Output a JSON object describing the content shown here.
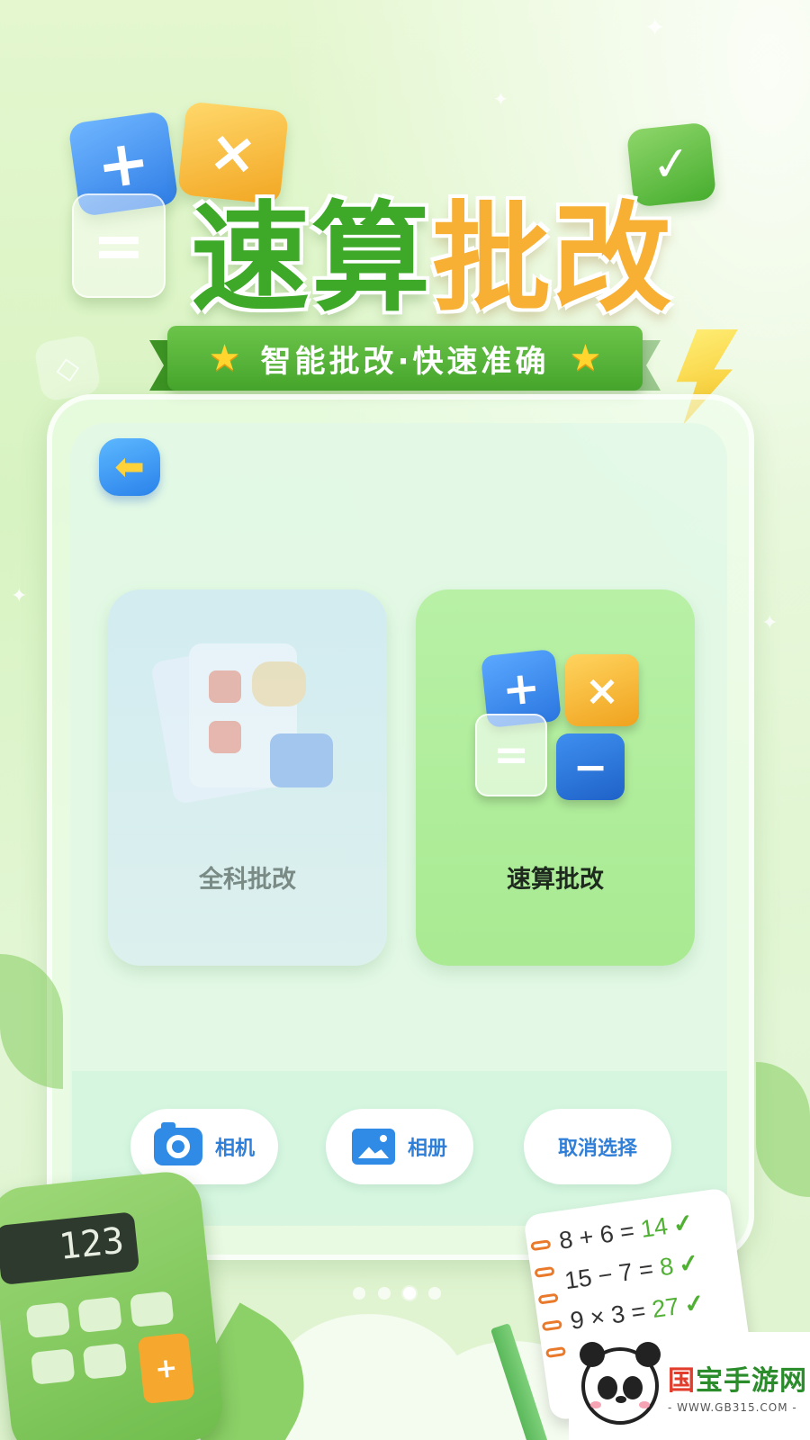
{
  "title": {
    "part_green": "速算",
    "part_orange": "批改"
  },
  "subtitle": "智能批改·快速准确",
  "decor_tiles": {
    "plus": "+",
    "times": "×",
    "equals": "=",
    "check": "✓"
  },
  "back_button": {
    "icon": "arrow-left-icon",
    "glyph": "⬅"
  },
  "cards": [
    {
      "id": "full",
      "label": "全科批改",
      "state": "unselected"
    },
    {
      "id": "quick",
      "label": "速算批改",
      "state": "selected"
    }
  ],
  "quick_tiles": {
    "plus": "+",
    "times": "×",
    "equals": "=",
    "minus": "−"
  },
  "actions": {
    "camera_label": "相机",
    "album_label": "相册",
    "cancel_label": "取消选择"
  },
  "pager": {
    "count": 4,
    "active_index": 2
  },
  "calculator": {
    "display": "123",
    "key_plus": "+"
  },
  "notebook": {
    "lines": [
      {
        "expr": "8 + 6 =",
        "answer": "14"
      },
      {
        "expr": "15 − 7 =",
        "answer": "8"
      },
      {
        "expr": "9 × 3 =",
        "answer": "27"
      }
    ]
  },
  "watermark": {
    "brand_red": "国",
    "brand_green": "宝手游网",
    "url": "- WWW.GB315.COM -"
  },
  "colors": {
    "accent_green": "#3ea828",
    "accent_orange": "#f7b034",
    "action_blue": "#2f7fd8"
  }
}
